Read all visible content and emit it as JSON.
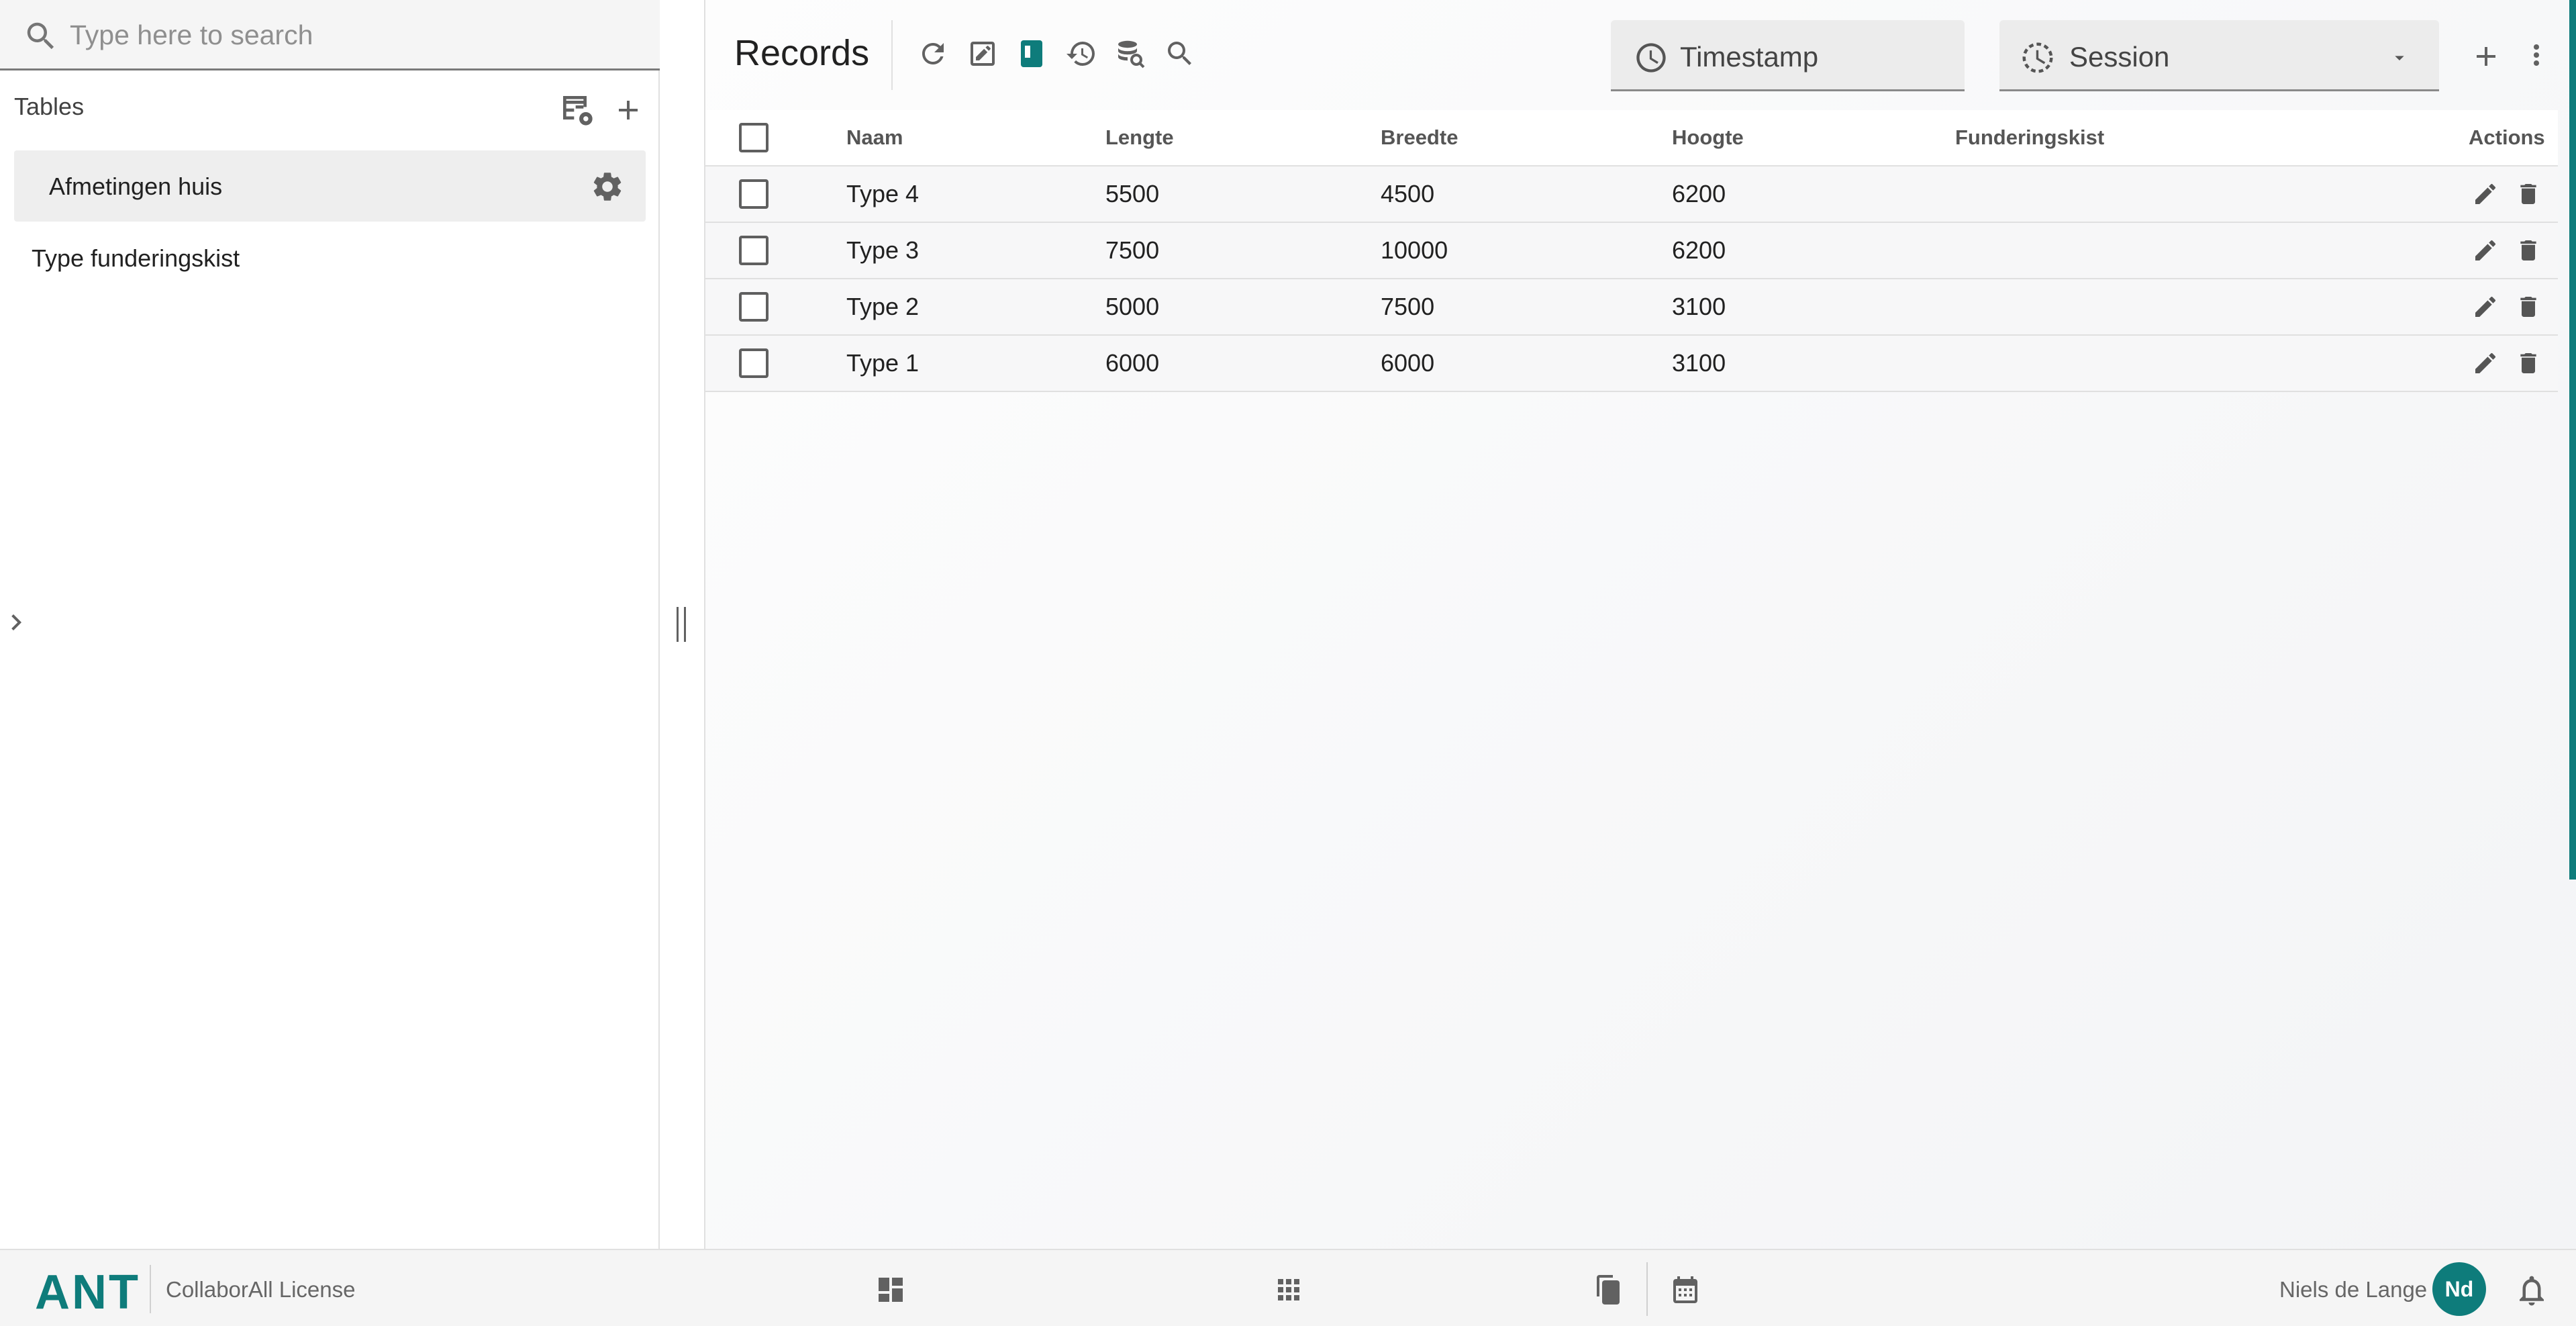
{
  "sidebar": {
    "search": {
      "placeholder": "Type here to search",
      "value": ""
    },
    "tables_heading": "Tables",
    "tables": [
      {
        "label": "Afmetingen huis",
        "active": true
      },
      {
        "label": "Type funderingskist",
        "active": false
      }
    ]
  },
  "main": {
    "title": "Records",
    "toolbar_icons": [
      "refresh-icon",
      "edit-icon",
      "panel-icon",
      "history-icon",
      "database-search-icon",
      "search-icon"
    ],
    "timestamp_label": "Timestamp",
    "session_label": "Session",
    "table": {
      "columns": [
        "Naam",
        "Lengte",
        "Breedte",
        "Hoogte",
        "Funderingskist",
        "Actions"
      ],
      "rows": [
        [
          "Type 4",
          "5500",
          "4500",
          "6200",
          ""
        ],
        [
          "Type 3",
          "7500",
          "10000",
          "6200",
          ""
        ],
        [
          "Type 2",
          "5000",
          "7500",
          "3100",
          ""
        ],
        [
          "Type 1",
          "6000",
          "6000",
          "3100",
          ""
        ]
      ]
    }
  },
  "footer": {
    "brand": "ANT",
    "license": "CollaborAll License",
    "user_name": "Niels de Lange",
    "user_initials": "Nd"
  },
  "colors": {
    "accent": "#0e7c7b"
  }
}
